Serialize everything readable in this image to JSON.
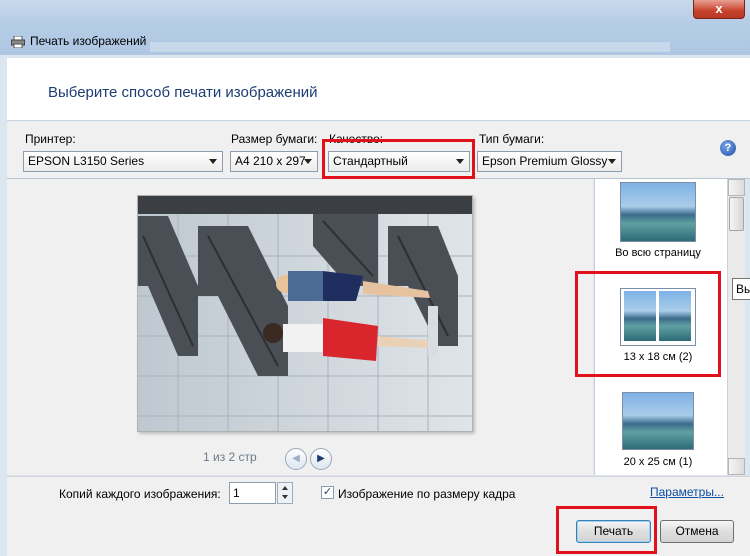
{
  "window": {
    "title": "Печать изображений",
    "close_symbol": "x"
  },
  "header": {
    "heading": "Выберите способ печати изображений"
  },
  "controls": {
    "printer": {
      "label": "Принтер:",
      "value": "EPSON L3150 Series"
    },
    "paper_size": {
      "label": "Размер бумаги:",
      "value": "A4 210 x 297"
    },
    "quality": {
      "label": "Качество:",
      "value": "Стандартный"
    },
    "paper_type": {
      "label": "Тип бумаги:",
      "value": "Epson Premium Glossy"
    },
    "help_symbol": "?"
  },
  "preview": {
    "pager_text": "1 из 2 стр"
  },
  "layouts": [
    {
      "caption": "Во всю страницу"
    },
    {
      "caption": "13 x 18 см (2)"
    },
    {
      "caption": "20 x 25 см (1)"
    }
  ],
  "tooltip_partial": "Вы",
  "bottom": {
    "copies_label": "Копий каждого изображения:",
    "copies_value": "1",
    "fit_label": "Изображение по размеру кадра",
    "fit_checked_symbol": "✓",
    "options_link": "Параметры...",
    "print_button": "Печать",
    "cancel_button": "Отмена"
  },
  "colors": {
    "highlight": "#e0111b",
    "heading": "#1e3d73",
    "link": "#0b4ea2"
  }
}
